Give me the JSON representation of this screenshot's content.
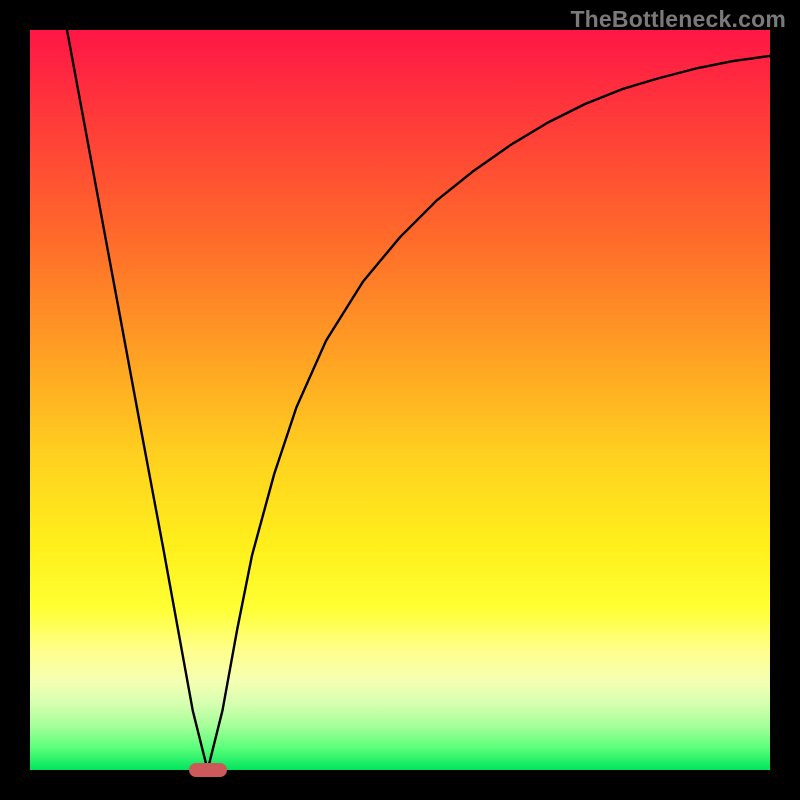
{
  "watermark": "TheBottleneck.com",
  "chart_data": {
    "type": "line",
    "title": "",
    "xlabel": "",
    "ylabel": "",
    "xlim": [
      0,
      100
    ],
    "ylim": [
      0,
      100
    ],
    "grid": false,
    "legend": false,
    "series": [
      {
        "name": "curve",
        "x": [
          5,
          10,
          15,
          18,
          20,
          22,
          24,
          26,
          28,
          30,
          33,
          36,
          40,
          45,
          50,
          55,
          60,
          65,
          70,
          75,
          80,
          85,
          90,
          95,
          100
        ],
        "y": [
          100,
          73,
          46,
          30,
          19,
          8,
          0,
          8,
          19,
          29,
          40,
          49,
          58,
          66,
          72,
          77,
          81,
          84.5,
          87.5,
          90,
          92,
          93.5,
          94.8,
          95.8,
          96.5
        ]
      }
    ],
    "marker": {
      "x": 24,
      "y": 0,
      "color": "#cc5a5a"
    },
    "background_gradient": {
      "top": "#ff1646",
      "mid": "#ffd21f",
      "bottom": "#00e45d"
    }
  }
}
